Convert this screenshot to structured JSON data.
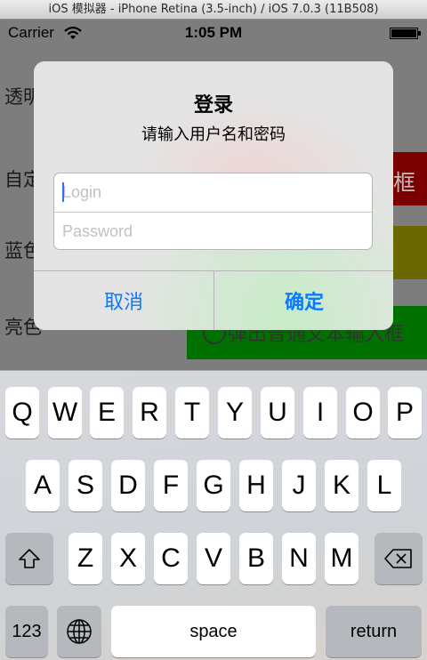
{
  "window": {
    "title": "iOS 模拟器 - iPhone Retina (3.5-inch) / iOS 7.0.3 (11B508)"
  },
  "status_bar": {
    "carrier": "Carrier",
    "time": "1:05 PM"
  },
  "background": {
    "rows": [
      {
        "label": "透明"
      },
      {
        "label": "自定",
        "button": "框"
      },
      {
        "label": "蓝色"
      },
      {
        "label": "亮色",
        "button": "弹出普通文本输入框"
      }
    ]
  },
  "dialog": {
    "title": "登录",
    "message": "请输入用户名和密码",
    "login_placeholder": "Login",
    "password_placeholder": "Password",
    "cancel_label": "取消",
    "ok_label": "确定"
  },
  "keyboard": {
    "row1": [
      "Q",
      "W",
      "E",
      "R",
      "T",
      "Y",
      "U",
      "I",
      "O",
      "P"
    ],
    "row2": [
      "A",
      "S",
      "D",
      "F",
      "G",
      "H",
      "J",
      "K",
      "L"
    ],
    "row3": [
      "Z",
      "X",
      "C",
      "V",
      "B",
      "N",
      "M"
    ],
    "numbers_label": "123",
    "space_label": "space",
    "return_label": "return"
  },
  "colors": {
    "accent": "#0a7aff",
    "red": "#cc0000",
    "olive": "#a8a400",
    "green": "#00b000"
  }
}
